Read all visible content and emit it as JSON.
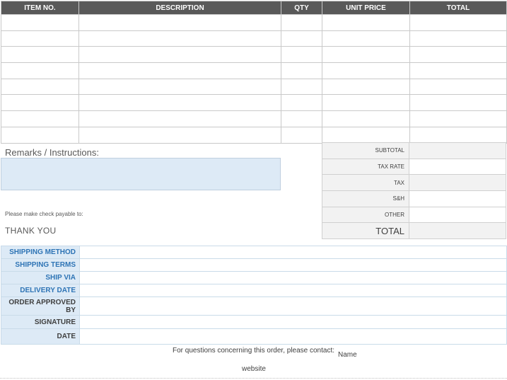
{
  "items_table": {
    "headers": [
      "ITEM NO.",
      "DESCRIPTION",
      "QTY",
      "UNIT PRICE",
      "TOTAL"
    ],
    "row_count": 8
  },
  "remarks": {
    "label": "Remarks / Instructions:",
    "value": ""
  },
  "payable_label": "Please make check payable to:",
  "thank_you": "THANK YOU",
  "totals": [
    {
      "label": "SUBTOTAL",
      "value": ""
    },
    {
      "label": "TAX RATE",
      "value": ""
    },
    {
      "label": "TAX",
      "value": ""
    },
    {
      "label": "S&H",
      "value": ""
    },
    {
      "label": "OTHER",
      "value": ""
    },
    {
      "label": "TOTAL",
      "value": ""
    }
  ],
  "shipping": [
    {
      "label": "SHIPPING METHOD",
      "value": ""
    },
    {
      "label": "SHIPPING TERMS",
      "value": ""
    },
    {
      "label": "SHIP VIA",
      "value": ""
    },
    {
      "label": "DELIVERY DATE",
      "value": ""
    },
    {
      "label": "ORDER APPROVED BY",
      "value": ""
    },
    {
      "label": "SIGNATURE",
      "value": ""
    },
    {
      "label": "DATE",
      "value": ""
    }
  ],
  "footer": {
    "contact_text": "For questions concerning this order, please contact:",
    "contact_name": "Name",
    "website": "website"
  }
}
